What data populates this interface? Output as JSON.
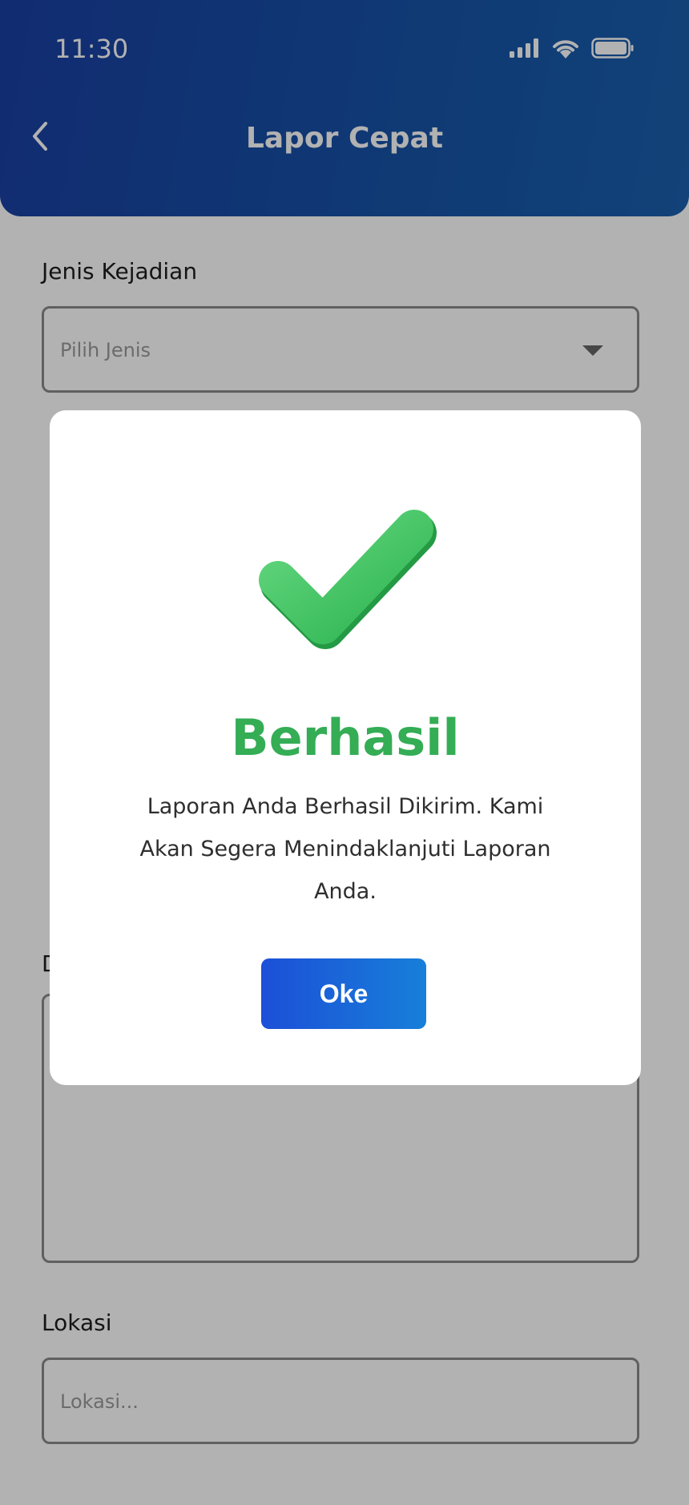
{
  "status_bar": {
    "time": "11:30"
  },
  "header": {
    "title": "Lapor Cepat"
  },
  "form": {
    "jenis_label": "Jenis Kejadian",
    "jenis_placeholder": "Pilih Jenis",
    "deskripsi_label": "D",
    "lokasi_label": "Lokasi",
    "lokasi_placeholder": "Lokasi..."
  },
  "modal": {
    "title": "Berhasil",
    "message": "Laporan Anda Berhasil Dikirim. Kami Akan Segera Menindaklanjuti Laporan Anda.",
    "ok_label": "Oke"
  },
  "colors": {
    "header_gradient_start": "#1a3fa3",
    "header_gradient_end": "#1a5fae",
    "success_green": "#34ad55",
    "button_gradient_start": "#1c4fd8",
    "button_gradient_end": "#177fd9"
  },
  "icons": {
    "back": "chevron-left-icon",
    "dropdown": "caret-down-icon",
    "success": "check-icon",
    "signal": "signal-icon",
    "wifi": "wifi-icon",
    "battery": "battery-icon"
  }
}
